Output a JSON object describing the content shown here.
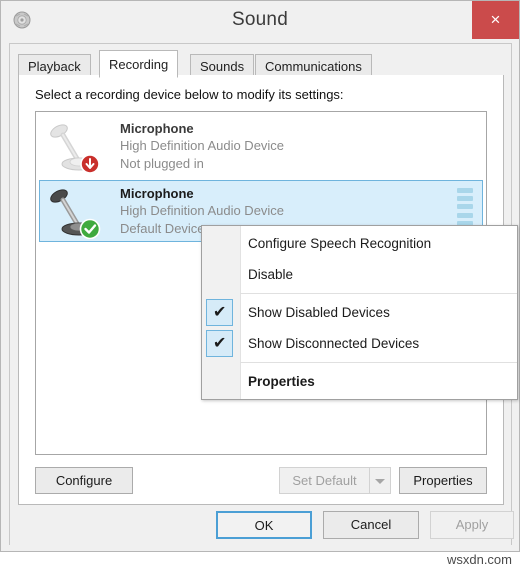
{
  "window": {
    "title": "Sound",
    "icon": "speaker-icon",
    "close_label": "×"
  },
  "tabs": [
    {
      "label": "Playback",
      "active": false
    },
    {
      "label": "Recording",
      "active": true
    },
    {
      "label": "Sounds",
      "active": false
    },
    {
      "label": "Communications",
      "active": false
    }
  ],
  "page": {
    "instruction": "Select a recording device below to modify its settings:"
  },
  "devices": [
    {
      "name": "Microphone",
      "driver": "High Definition Audio Device",
      "status": "Not plugged in",
      "badge": "unplugged-badge",
      "selected": false,
      "meter": false
    },
    {
      "name": "Microphone",
      "driver": "High Definition Audio Device",
      "status": "Default Device",
      "badge": "default-check-badge",
      "selected": true,
      "meter": true
    }
  ],
  "context_menu": [
    {
      "label": "Configure Speech Recognition",
      "type": "item",
      "checked": false,
      "bold": false
    },
    {
      "label": "Disable",
      "type": "item",
      "checked": false,
      "bold": false
    },
    {
      "type": "separator"
    },
    {
      "label": "Show Disabled Devices",
      "type": "item",
      "checked": true,
      "bold": false
    },
    {
      "label": "Show Disconnected Devices",
      "type": "item",
      "checked": true,
      "bold": false
    },
    {
      "type": "separator"
    },
    {
      "label": "Properties",
      "type": "item",
      "checked": false,
      "bold": true
    }
  ],
  "buttons": {
    "configure": "Configure",
    "set_default": "Set Default",
    "properties": "Properties",
    "ok": "OK",
    "cancel": "Cancel",
    "apply": "Apply"
  },
  "watermark": "wsxdn.com",
  "colors": {
    "close_red": "#cb4b4b",
    "selection_fill": "#d8eefb",
    "selection_border": "#6fb4dd",
    "focus_blue": "#4b9fd5",
    "window_gray": "#f0f0f0"
  }
}
